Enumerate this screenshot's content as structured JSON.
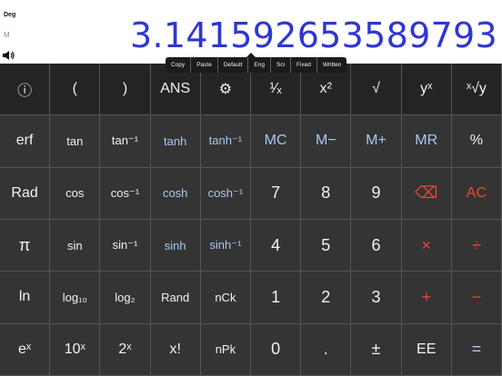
{
  "status": {
    "angle_mode": "Deg",
    "memory_indicator": "M",
    "sound_icon": "speaker-icon"
  },
  "display": {
    "value": "3.141592653589793"
  },
  "context_menu": {
    "items": [
      "Copy",
      "Paste",
      "Default",
      "Eng",
      "Sci",
      "Fixed",
      "Written"
    ]
  },
  "keypad": {
    "rows": [
      [
        "ⓘ",
        "(",
        ")",
        "ANS",
        "⚙",
        "¹⁄ₓ",
        "x²",
        "√",
        "yˣ",
        "ˣ√y"
      ],
      [
        "erf",
        "tan",
        "tan⁻¹",
        "tanh",
        "tanh⁻¹",
        "MC",
        "M−",
        "M+",
        "MR",
        "%"
      ],
      [
        "Rad",
        "cos",
        "cos⁻¹",
        "cosh",
        "cosh⁻¹",
        "7",
        "8",
        "9",
        "⌫",
        "AC"
      ],
      [
        "π",
        "sin",
        "sin⁻¹",
        "sinh",
        "sinh⁻¹",
        "4",
        "5",
        "6",
        "×",
        "÷"
      ],
      [
        "ln",
        "log₁₀",
        "log₂",
        "Rand",
        "nCk",
        "1",
        "2",
        "3",
        "+",
        "−"
      ],
      [
        "eˣ",
        "10ˣ",
        "2ˣ",
        "x!",
        "nPk",
        "0",
        ".",
        "±",
        "EE",
        "="
      ]
    ]
  },
  "colors": {
    "display_text": "#2f36d1",
    "key_text": "#f2f2f2",
    "memory_key_text": "#a9c8f0",
    "operator_key_text": "#f04438",
    "key_background": "#343434",
    "key_background_dark": "#242424"
  }
}
